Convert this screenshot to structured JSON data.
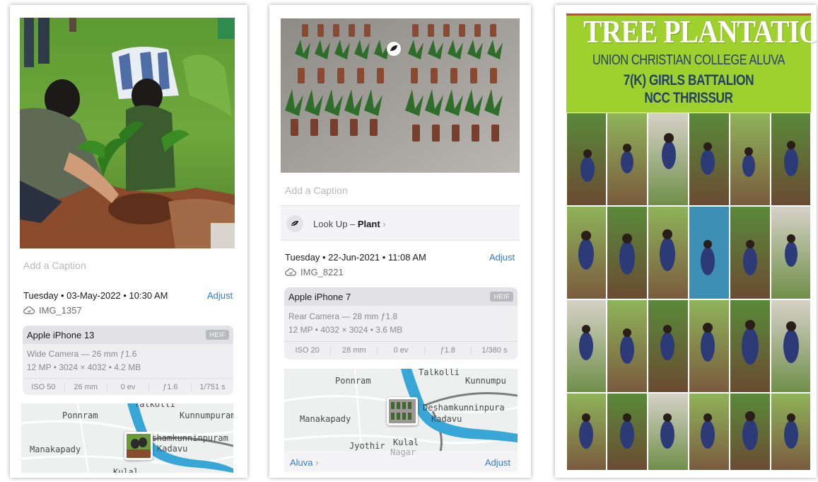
{
  "panel1": {
    "caption_placeholder": "Add a Caption",
    "date": "Tuesday • 03-May-2022 • 10:30 AM",
    "adjust_label": "Adjust",
    "filename": "IMG_1357",
    "camera_model": "Apple iPhone 13",
    "format_badge": "HEIF",
    "lens_line": "Wide Camera — 26 mm ƒ1.6",
    "spec_line": "12 MP  •  3024 × 4032  •  4.2 MB",
    "exif": [
      "ISO 50",
      "26 mm",
      "0 ev",
      "ƒ1.6",
      "1/751 s"
    ],
    "map_labels": {
      "top": "Talkolli",
      "ponnram": "Ponnram",
      "kunnumpuram": "Kunnumpuram",
      "deshamkunninpuram": "Deshamkunninpuram",
      "kadavu": "Kadavu",
      "manakapady": "Manakapady",
      "kulal": "Kulal"
    }
  },
  "panel2": {
    "caption_placeholder": "Add a Caption",
    "lookup_prefix": "Look Up –",
    "lookup_subject": "Plant",
    "date": "Tuesday • 22-Jun-2021 • 11:08 AM",
    "adjust_label": "Adjust",
    "filename": "IMG_8221",
    "camera_model": "Apple iPhone 7",
    "format_badge": "HEIF",
    "lens_line": "Rear Camera — 28 mm ƒ1.8",
    "spec_line": "12 MP  •  4032 × 3024  •  3.6 MB",
    "exif": [
      "ISO 20",
      "28 mm",
      "0 ev",
      "ƒ1.8",
      "1/380 s"
    ],
    "map_labels": {
      "talkolli": "Talkolli",
      "ponnram": "Ponnram",
      "kunnumpuram": "Kunnumpu",
      "deshamkunninpuram": "Deshamkunninpura",
      "kadavu": "Kadavu",
      "manakapady": "Manakapady",
      "jyothir": "Jyothir",
      "kulal": "Kulal",
      "nagar": "Nagar"
    },
    "location_label": "Aluva",
    "bottom_adjust_label": "Adjust"
  },
  "poster": {
    "title": "TREE PLANTATION",
    "line1": "UNION CHRISTIAN COLLEGE ALUVA",
    "line2": "7(K) GIRLS BATTALION",
    "line3": "NCC  THRISSUR"
  },
  "colors": {
    "accent": "#2f7ae5",
    "poster_header": "#9fd12e",
    "poster_text": "#27406b",
    "river": "#38a7d8"
  },
  "icons": {
    "cloud": "cloud-icon",
    "leaf": "leaf-icon",
    "chevron": "chevron-right-icon"
  }
}
